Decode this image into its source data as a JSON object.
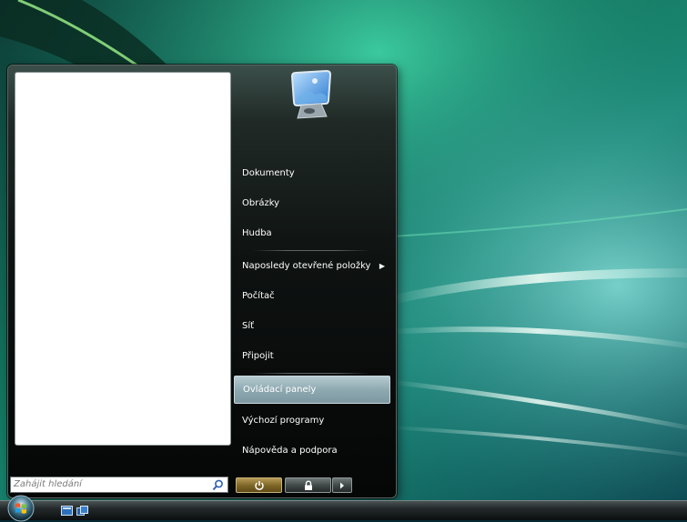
{
  "start_menu": {
    "search": {
      "placeholder": "Zahájit hledání",
      "icon": "search-icon"
    },
    "user_picture_icon": "user-picture-icon",
    "items": [
      {
        "label": "Dokumenty"
      },
      {
        "label": "Obrázky"
      },
      {
        "label": "Hudba"
      },
      {
        "label": "Naposledy otevřené položky",
        "has_submenu": true
      },
      {
        "label": "Počítač"
      },
      {
        "label": "Síť"
      },
      {
        "label": "Připojit"
      },
      {
        "label": "Ovládací panely",
        "highlighted": true
      },
      {
        "label": "Výchozí programy"
      },
      {
        "label": "Nápověda a podpora"
      }
    ],
    "power_buttons": {
      "power_icon": "power-icon",
      "lock_icon": "lock-icon",
      "options_icon": "arrow-right-icon"
    }
  },
  "taskbar": {
    "start_icon": "windows-orb-icon",
    "quick_launch": [
      "show-desktop-icon",
      "switch-windows-icon"
    ]
  },
  "colors": {
    "highlight": "#8fa9b1",
    "menu_bg": "#0e1211",
    "power_accent": "#7c6426",
    "desktop_green": "#2fae7a"
  }
}
